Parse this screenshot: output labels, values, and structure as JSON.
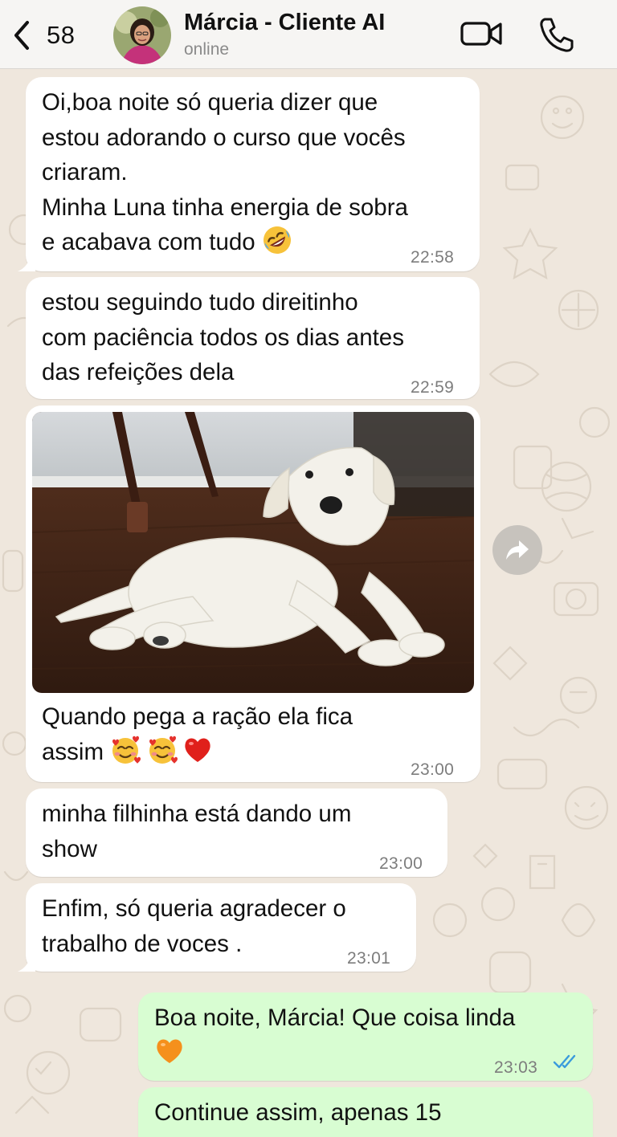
{
  "header": {
    "back_count": "58",
    "contact_name": "Márcia - Cliente AI",
    "contact_status": "online"
  },
  "messages": [
    {
      "text": "Oi,boa noite só queria dizer que\nestou adorando o curso que vocês\ncriaram.\nMinha Luna tinha energia de sobra\ne acabava com tudo",
      "emoji": "rolling-on-floor-laughing-emoji",
      "time": "22:58"
    },
    {
      "text": "estou seguindo tudo direitinho\ncom paciência todos os dias antes\ndas refeições dela",
      "time": "22:59"
    },
    {
      "text": "Quando pega a ração ela fica\nassim",
      "emoji": "smiling-face-with-hearts-emoji x2 + red-heart-emoji",
      "time": "23:00",
      "image": "white labrador puppy lying on wooden floor"
    },
    {
      "text": "minha filhinha está dando um\nshow",
      "time": "23:00"
    },
    {
      "text": "Enfim, só queria agradecer o\ntrabalho de voces .",
      "time": "23:01"
    },
    {
      "text": "Boa noite, Márcia! Que coisa linda",
      "emoji": "orange-heart-emoji",
      "time": "23:03",
      "status": "read-double-check"
    },
    {
      "text": "Continue assim, apenas 15"
    }
  ],
  "colors": {
    "wallpaper": "#efe7dd",
    "incoming_bubble": "#ffffff",
    "outgoing_bubble": "#d8fdd2",
    "read_check": "#3a9bdc",
    "header_bg": "#f6f5f3"
  }
}
